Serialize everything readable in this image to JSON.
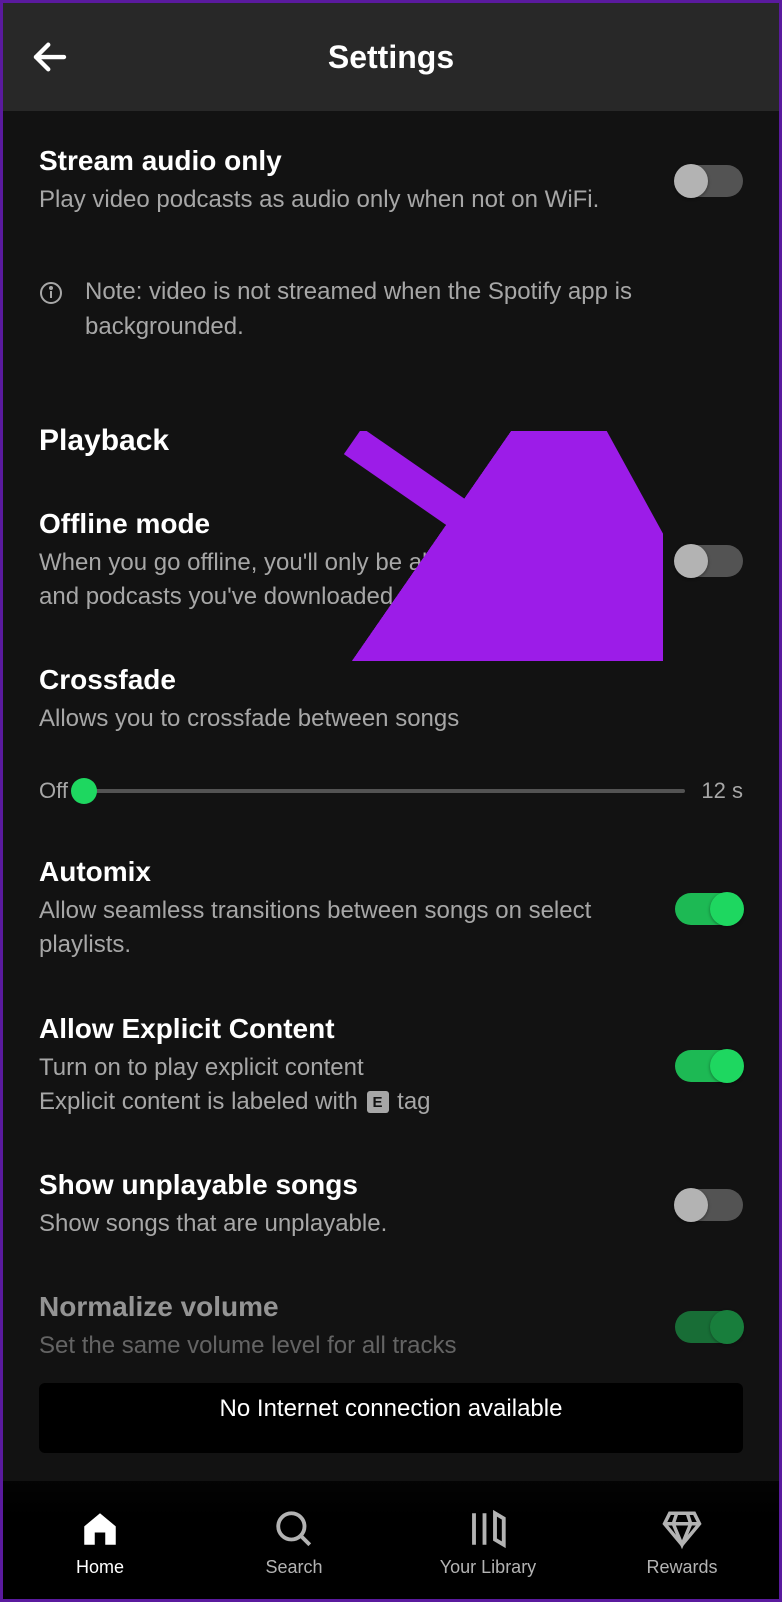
{
  "header": {
    "title": "Settings"
  },
  "settings": {
    "streamAudio": {
      "title": "Stream audio only",
      "desc": "Play video podcasts as audio only when not on WiFi.",
      "on": false
    },
    "note": "Note: video is not streamed when the Spotify app is backgrounded.",
    "sectionPlayback": "Playback",
    "offline": {
      "title": "Offline mode",
      "desc": "When you go offline, you'll only be able to play the music and podcasts you've downloaded.",
      "on": false
    },
    "crossfade": {
      "title": "Crossfade",
      "desc": "Allows you to crossfade between songs",
      "min_label": "Off",
      "max_label": "12 s",
      "value": 0
    },
    "automix": {
      "title": "Automix",
      "desc": "Allow seamless transitions between songs on select playlists.",
      "on": true
    },
    "explicit": {
      "title": "Allow Explicit Content",
      "desc_line1": "Turn on to play explicit content",
      "desc_line2a": "Explicit content is labeled with ",
      "desc_line2b": " tag",
      "badge": "E",
      "on": true
    },
    "unplayable": {
      "title": "Show unplayable songs",
      "desc": "Show songs that are unplayable.",
      "on": false
    },
    "normalize": {
      "title": "Normalize volume",
      "desc": "Set the same volume level for all tracks",
      "on": true
    }
  },
  "toast": "No Internet connection available",
  "nav": {
    "home": "Home",
    "search": "Search",
    "library": "Your Library",
    "rewards": "Rewards"
  },
  "colors": {
    "accent": "#1ed760",
    "arrow": "#9c1ce8"
  }
}
